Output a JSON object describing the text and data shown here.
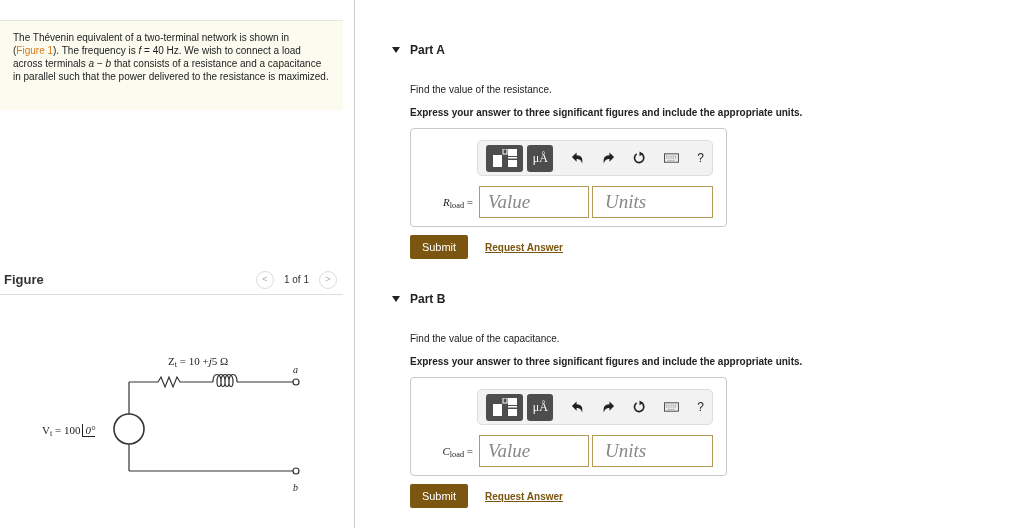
{
  "problem": {
    "before": "The Thévenin equivalent of a two-terminal network is shown in (",
    "link": "Figure 1",
    "after": "). The frequency is *f* = 40 Hz. We wish to connect a load across terminals *a* − *b* that consists of a resistance and a capacitance in parallel such that the power delivered to the resistance is maximized."
  },
  "figure": {
    "title": "Figure",
    "pager": "1 of 1",
    "prev": "<",
    "next": ">",
    "impedance_label": "Z$_{t}$ = 10 +",
    "impedance_imag": "j",
    "impedance_rest": "5 Ω",
    "source_label": "V$_{t}$ = 100",
    "source_angle": "0°",
    "terminal_top": "a",
    "terminal_bottom": "b"
  },
  "parts": [
    {
      "title": "Part A",
      "expanded": true,
      "prompt": "Find the value of the resistance.",
      "instruction": "Express your answer to three significant figures and include the appropriate units.",
      "units_tool": "μÅ",
      "help": "?",
      "symbol": "R",
      "subscript": "load",
      "equals": "=",
      "value_placeholder": "Value",
      "units_placeholder": "Units",
      "submit": "Submit",
      "request": "Request Answer"
    },
    {
      "title": "Part B",
      "expanded": true,
      "prompt": "Find the value of the capacitance.",
      "instruction": "Express your answer to three significant figures and include the appropriate units.",
      "units_tool": "μÅ",
      "help": "?",
      "symbol": "C",
      "subscript": "load",
      "equals": "=",
      "value_placeholder": "Value",
      "units_placeholder": "Units",
      "submit": "Submit",
      "request": "Request Answer"
    }
  ]
}
